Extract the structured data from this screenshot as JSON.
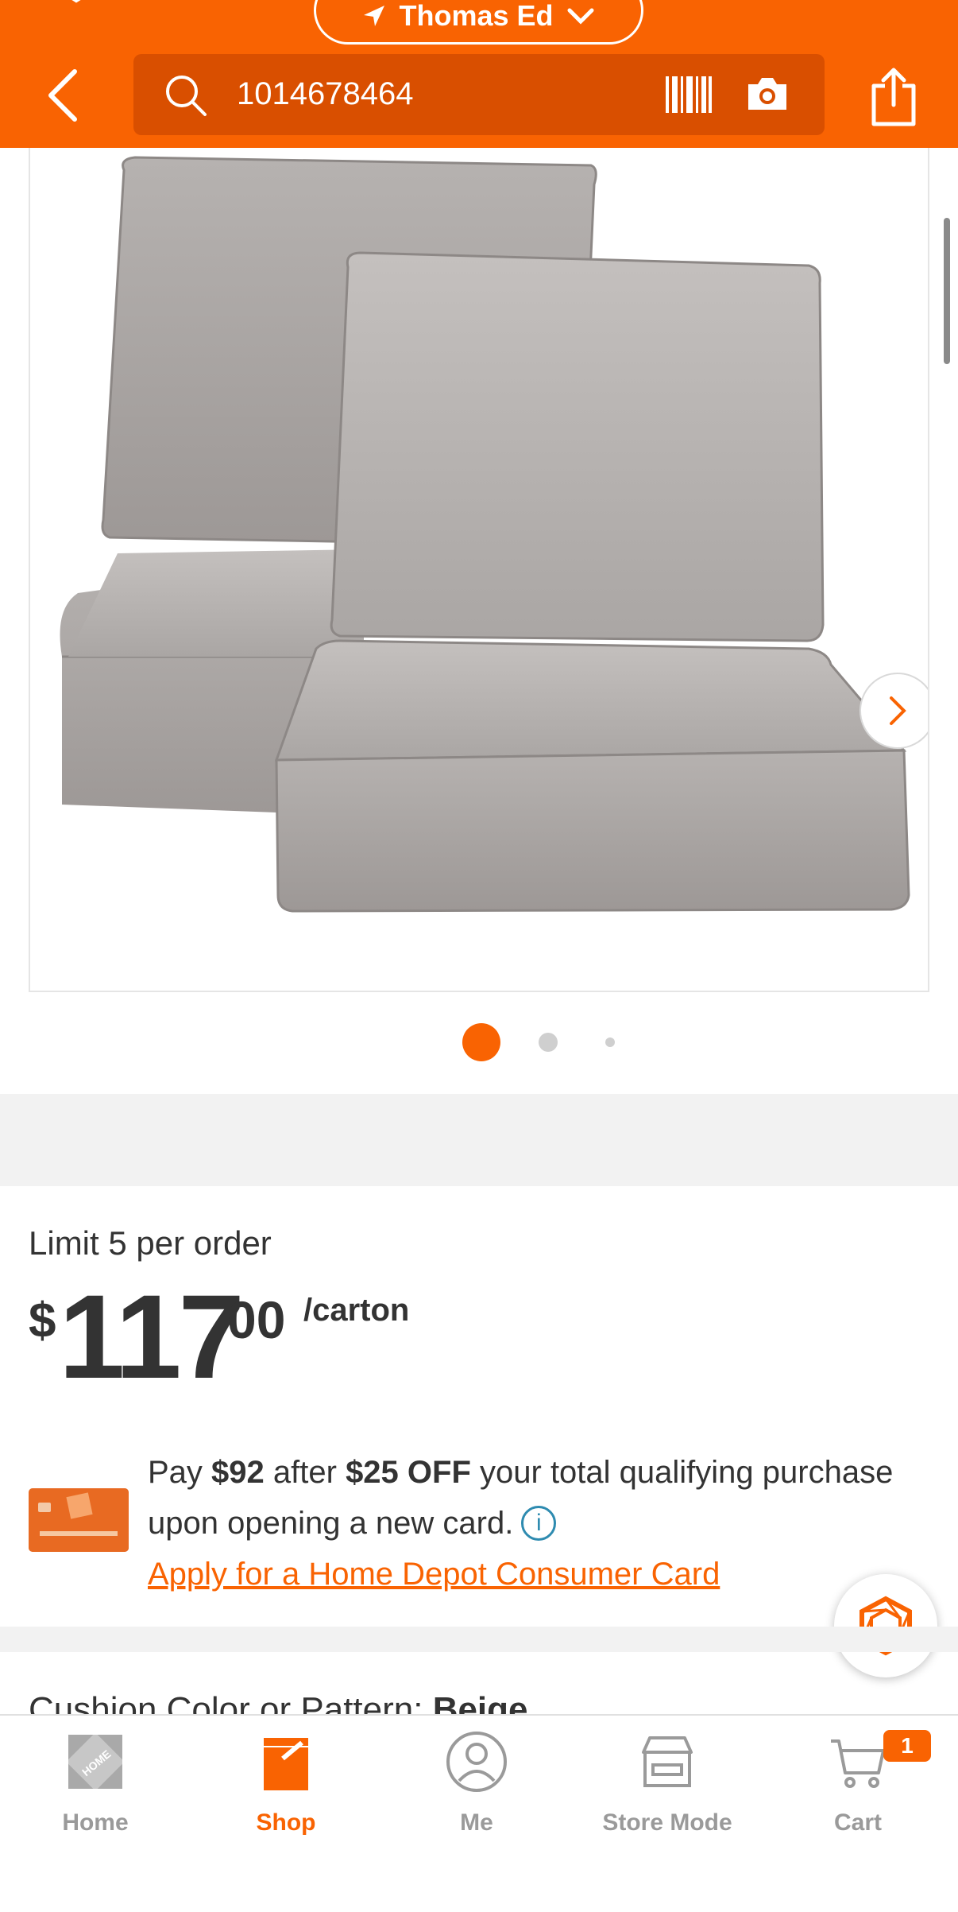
{
  "header": {
    "location_label": "Thomas Ed",
    "search_query": "1014678464"
  },
  "gallery": {
    "image_alt": "Gray outdoor deep seating cushions",
    "total_images": 3,
    "active_index": 1
  },
  "product": {
    "limit_text": "Limit 5 per order",
    "currency": "$",
    "price_dollars": "117",
    "price_cents": "00",
    "price_unit": "/carton"
  },
  "offer": {
    "pay_prefix": "Pay ",
    "pay_amount": "$92",
    "after": " after ",
    "discount": "$25 OFF",
    "rest": " your total qualifying purchase upon opening a new card.",
    "info_symbol": "i",
    "apply_link": "Apply for a Home Depot Consumer Card"
  },
  "cushion": {
    "label": "Cushion Color or Pattern: ",
    "value": "Beige"
  },
  "bottom_nav": {
    "items": [
      {
        "label": "Home",
        "icon": "home-depot-logo-icon"
      },
      {
        "label": "Shop",
        "icon": "shop-icon"
      },
      {
        "label": "Me",
        "icon": "person-icon"
      },
      {
        "label": "Store Mode",
        "icon": "store-icon"
      },
      {
        "label": "Cart",
        "icon": "cart-icon"
      }
    ],
    "active": "Shop",
    "cart_count": "1"
  },
  "colors": {
    "brand_orange": "#f96302",
    "search_bg": "#d94f00",
    "info_blue": "#2e8bb0",
    "inactive_gray": "#9a9a9a"
  }
}
